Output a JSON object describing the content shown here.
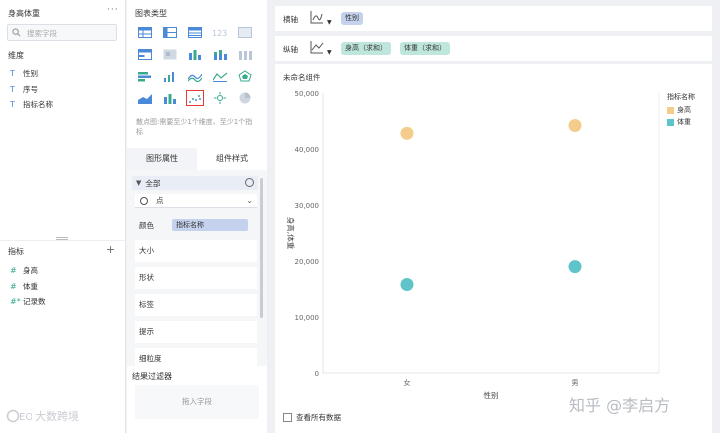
{
  "left_panel": {
    "dataset_title": "身高体重",
    "more_label": "···",
    "search_placeholder": "搜索字段",
    "dimension_title": "维度",
    "dimensions": [
      {
        "type_icon": "T",
        "label": "性别"
      },
      {
        "type_icon": "T",
        "label": "序号"
      },
      {
        "type_icon": "T",
        "label": "指标名称"
      }
    ],
    "measure_title": "指标",
    "add_label": "+",
    "measures": [
      {
        "type_icon": "#",
        "label": "身高"
      },
      {
        "type_icon": "#",
        "label": "体重"
      },
      {
        "type_icon": "#*",
        "label": "记录数"
      }
    ],
    "watermark": "大数跨境"
  },
  "middle_panel": {
    "chart_type_title": "图表类型",
    "chart_hint": "散点图:需要至少1个维度、至少1个指标",
    "tabs": [
      "图形属性",
      "组件样式"
    ],
    "prop_all_label": "全部",
    "mark_type_value": "点",
    "color_label": "颜色",
    "color_field": "指标名称",
    "props": [
      "大小",
      "形状",
      "标签",
      "提示",
      "细粒度"
    ],
    "filter_title": "结果过滤器",
    "filter_placeholder": "拖入字段"
  },
  "shelves": {
    "x_label": "横轴",
    "x_fields": [
      "性别"
    ],
    "y_label": "纵轴",
    "y_fields": [
      "身高（求和）",
      "体重（求和）"
    ]
  },
  "canvas": {
    "title": "未命名组件",
    "show_all_label": "查看所有数据",
    "watermark": "知乎 @李启方"
  },
  "colors": {
    "height": "#f4cd8c",
    "weight": "#5ec4c9"
  },
  "chart_data": {
    "type": "scatter",
    "title": "",
    "xlabel": "性别",
    "ylabel": "身高,体重",
    "categories": [
      "女",
      "男"
    ],
    "ylim": [
      0,
      50000
    ],
    "yticks": [
      "0",
      "10,000",
      "20,000",
      "30,000",
      "40,000",
      "50,000"
    ],
    "legend_title": "指标名称",
    "legend_position": "top-right",
    "series": [
      {
        "name": "身高",
        "values": [
          42800,
          44200
        ]
      },
      {
        "name": "体重",
        "values": [
          15800,
          19000
        ]
      }
    ]
  }
}
